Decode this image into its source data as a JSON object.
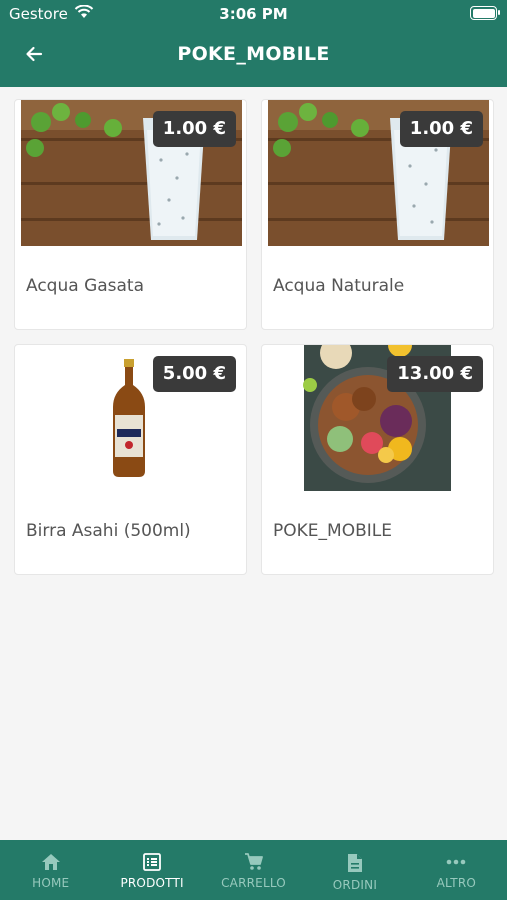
{
  "status_bar": {
    "carrier": "Gestore",
    "time": "3:06 PM"
  },
  "header": {
    "title": "POKE_MOBILE",
    "back_icon": "arrow-left-icon"
  },
  "products": [
    {
      "name": "Acqua Gasata",
      "price": "1.00 €",
      "image": "sparkling-water-glass"
    },
    {
      "name": "Acqua Naturale",
      "price": "1.00 €",
      "image": "still-water-glass"
    },
    {
      "name": "Birra Asahi (500ml)",
      "price": "5.00 €",
      "image": "beer-bottle"
    },
    {
      "name": "POKE_MOBILE",
      "price": "13.00 €",
      "image": "poke-bowl"
    }
  ],
  "tabbar": {
    "active": "PRODOTTI",
    "tabs": [
      {
        "label": "HOME",
        "icon": "home-icon"
      },
      {
        "label": "PRODOTTI",
        "icon": "list-icon"
      },
      {
        "label": "CARRELLO",
        "icon": "cart-icon"
      },
      {
        "label": "ORDINI",
        "icon": "document-icon"
      },
      {
        "label": "ALTRO",
        "icon": "more-icon"
      }
    ]
  },
  "colors": {
    "primary": "#247a68",
    "price_badge": "#3a3a3a",
    "background": "#f5f5f5"
  }
}
